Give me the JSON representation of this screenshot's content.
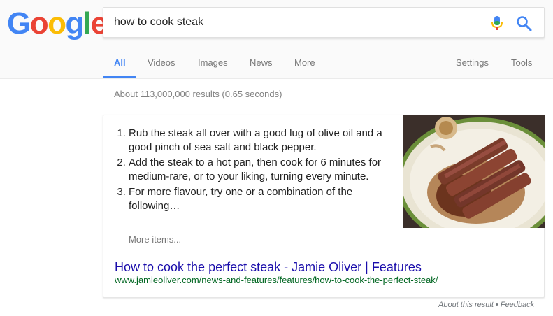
{
  "logo": {
    "letters": [
      "G",
      "o",
      "o",
      "g",
      "l",
      "e"
    ]
  },
  "search": {
    "query": "how to cook steak"
  },
  "icons": {
    "mic": "microphone-icon",
    "search": "search-icon"
  },
  "tabs": [
    {
      "label": "All",
      "active": true
    },
    {
      "label": "Videos"
    },
    {
      "label": "Images"
    },
    {
      "label": "News"
    },
    {
      "label": "More"
    },
    {
      "label": "Settings"
    },
    {
      "label": "Tools"
    }
  ],
  "stats": "About 113,000,000 results (0.65 seconds)",
  "snippet": {
    "steps": [
      "Rub the steak all over with a good lug of olive oil and a good pinch of sea salt and black pepper.",
      "Add the steak to a hot pan, then cook for 6 minutes for medium-rare, or to your liking, turning every minute.",
      "For more flavour, try one or a combination of the following…"
    ],
    "more_items": "More items...",
    "image_alt": "sliced steak on a plate",
    "title": "How to cook the perfect steak - Jamie Oliver | Features",
    "url": "www.jamieoliver.com/news-and-features/features/how-to-cook-the-perfect-steak/"
  },
  "footer": {
    "about": "About this result",
    "separator": " • ",
    "feedback": "Feedback"
  },
  "colors": {
    "accent": "#4285f4",
    "link": "#1a0dab",
    "url": "#006621"
  }
}
